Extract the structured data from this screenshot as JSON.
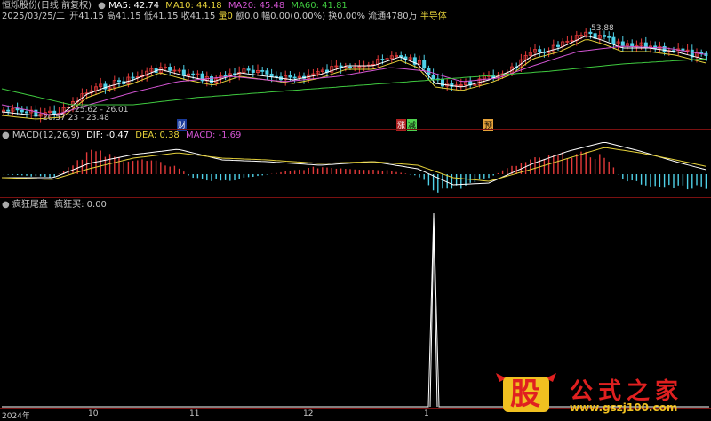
{
  "colors": {
    "up": "#e53a3a",
    "down": "#4fd1e8",
    "ma5": "#ffffff",
    "ma10": "#e6d23a",
    "ma20": "#d455d4",
    "ma60": "#3fc93f",
    "separator": "#7a1010",
    "logo_red": "#e02020",
    "logo_yellow": "#f0c020"
  },
  "header": {
    "title": "恒烁股份(日线 前复权)",
    "ma5": "MA5: 42.74",
    "ma10": "MA10: 44.18",
    "ma20": "MA20: 45.48",
    "ma60": "MA60: 41.81",
    "date": "2025/03/25/二",
    "open": "开41.15",
    "high": "高41.15",
    "low": "低41.15",
    "close": "收41.15",
    "volume": "量0",
    "amount": "额0.0",
    "change": "幅0.00(0.00%)",
    "turnover": "换0.00%",
    "float": "流通4780万",
    "industry": "半导体"
  },
  "price_chart": {
    "high_label": "53.88",
    "low_label_1": "25.62 - 26.01",
    "low_label_2": "20.57 23 - 23.48",
    "events": [
      "财",
      "涨",
      "减",
      "预"
    ]
  },
  "macd": {
    "title": "MACD(12,26,9)",
    "dif": "DIF: -0.47",
    "dea": "DEA: 0.38",
    "macd": "MACD: -1.69"
  },
  "indicator": {
    "title": "疯狂尾盘",
    "label": "疯狂买: 0.00"
  },
  "time_axis": [
    "2024年",
    "10",
    "11",
    "12",
    "1"
  ],
  "watermark": {
    "logo_char": "股",
    "site_name": "公式之家",
    "url": "www.gszj100.com"
  },
  "chart_data": {
    "type": "line",
    "title": "恒烁股份(日线 前复权)",
    "series": [
      {
        "name": "MA5",
        "value": 42.74
      },
      {
        "name": "MA10",
        "value": 44.18
      },
      {
        "name": "MA20",
        "value": 45.48
      },
      {
        "name": "MA60",
        "value": 41.81
      }
    ],
    "price_high": 53.88,
    "price_low": 20.57,
    "last_bar": {
      "date": "2025/03/25",
      "open": 41.15,
      "high": 41.15,
      "low": 41.15,
      "close": 41.15,
      "volume": 0
    },
    "macd": {
      "DIF": -0.47,
      "DEA": 0.38,
      "MACD": -1.69
    },
    "indicator_value": 0.0
  }
}
